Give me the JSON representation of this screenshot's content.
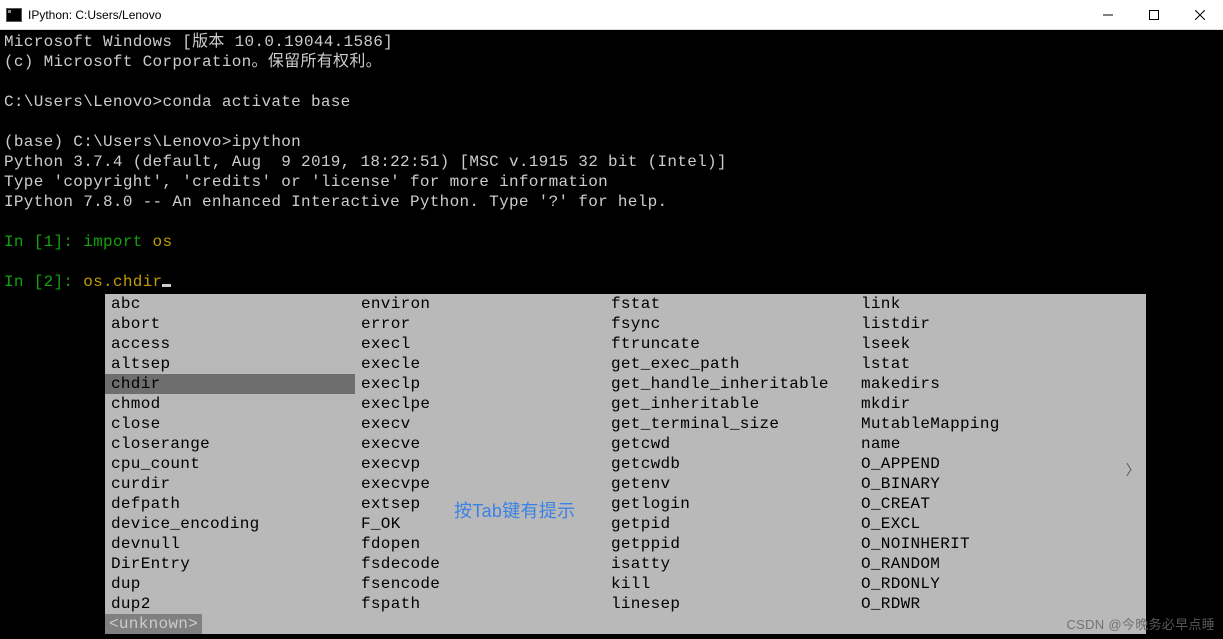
{
  "window": {
    "title": "IPython: C:Users/Lenovo"
  },
  "terminal": {
    "line1": "Microsoft Windows [版本 10.0.19044.1586]",
    "line2": "(c) Microsoft Corporation。保留所有权利。",
    "prompt1_path": "C:\\Users\\Lenovo>",
    "prompt1_cmd": "conda activate base",
    "prompt2_path": "(base) C:\\Users\\Lenovo>",
    "prompt2_cmd": "ipython",
    "python_ver": "Python 3.7.4 (default, Aug  9 2019, 18:22:51) [MSC v.1915 32 bit (Intel)]",
    "type_info": "Type 'copyright', 'credits' or 'license' for more information",
    "ipython_ver": "IPython 7.8.0 -- An enhanced Interactive Python. Type '?' for help.",
    "in1_label": "In [1]: ",
    "in1_kw": "import",
    "in1_mod": " os",
    "in2_label": "In [2]: ",
    "in2_code": "os.chdir"
  },
  "completion": {
    "selected": "chdir",
    "columns": [
      [
        "abc",
        "abort",
        "access",
        "altsep",
        "chdir",
        "chmod",
        "close",
        "closerange",
        "cpu_count",
        "curdir",
        "defpath",
        "device_encoding",
        "devnull",
        "DirEntry",
        "dup",
        "dup2"
      ],
      [
        "environ",
        "error",
        "execl",
        "execle",
        "execlp",
        "execlpe",
        "execv",
        "execve",
        "execvp",
        "execvpe",
        "extsep",
        "F_OK",
        "fdopen",
        "fsdecode",
        "fsencode",
        "fspath"
      ],
      [
        "fstat",
        "fsync",
        "ftruncate",
        "get_exec_path",
        "get_handle_inheritable",
        "get_inheritable",
        "get_terminal_size",
        "getcwd",
        "getcwdb",
        "getenv",
        "getlogin",
        "getpid",
        "getppid",
        "isatty",
        "kill",
        "linesep"
      ],
      [
        "link",
        "listdir",
        "lseek",
        "lstat",
        "makedirs",
        "mkdir",
        "MutableMapping",
        "name",
        "O_APPEND",
        "O_BINARY",
        "O_CREAT",
        "O_EXCL",
        "O_NOINHERIT",
        "O_RANDOM",
        "O_RDONLY",
        "O_RDWR"
      ]
    ],
    "status": "<unknown>"
  },
  "annotation": {
    "text": "按Tab键有提示"
  },
  "watermark": {
    "text": "CSDN @今晚务必早点睡"
  }
}
